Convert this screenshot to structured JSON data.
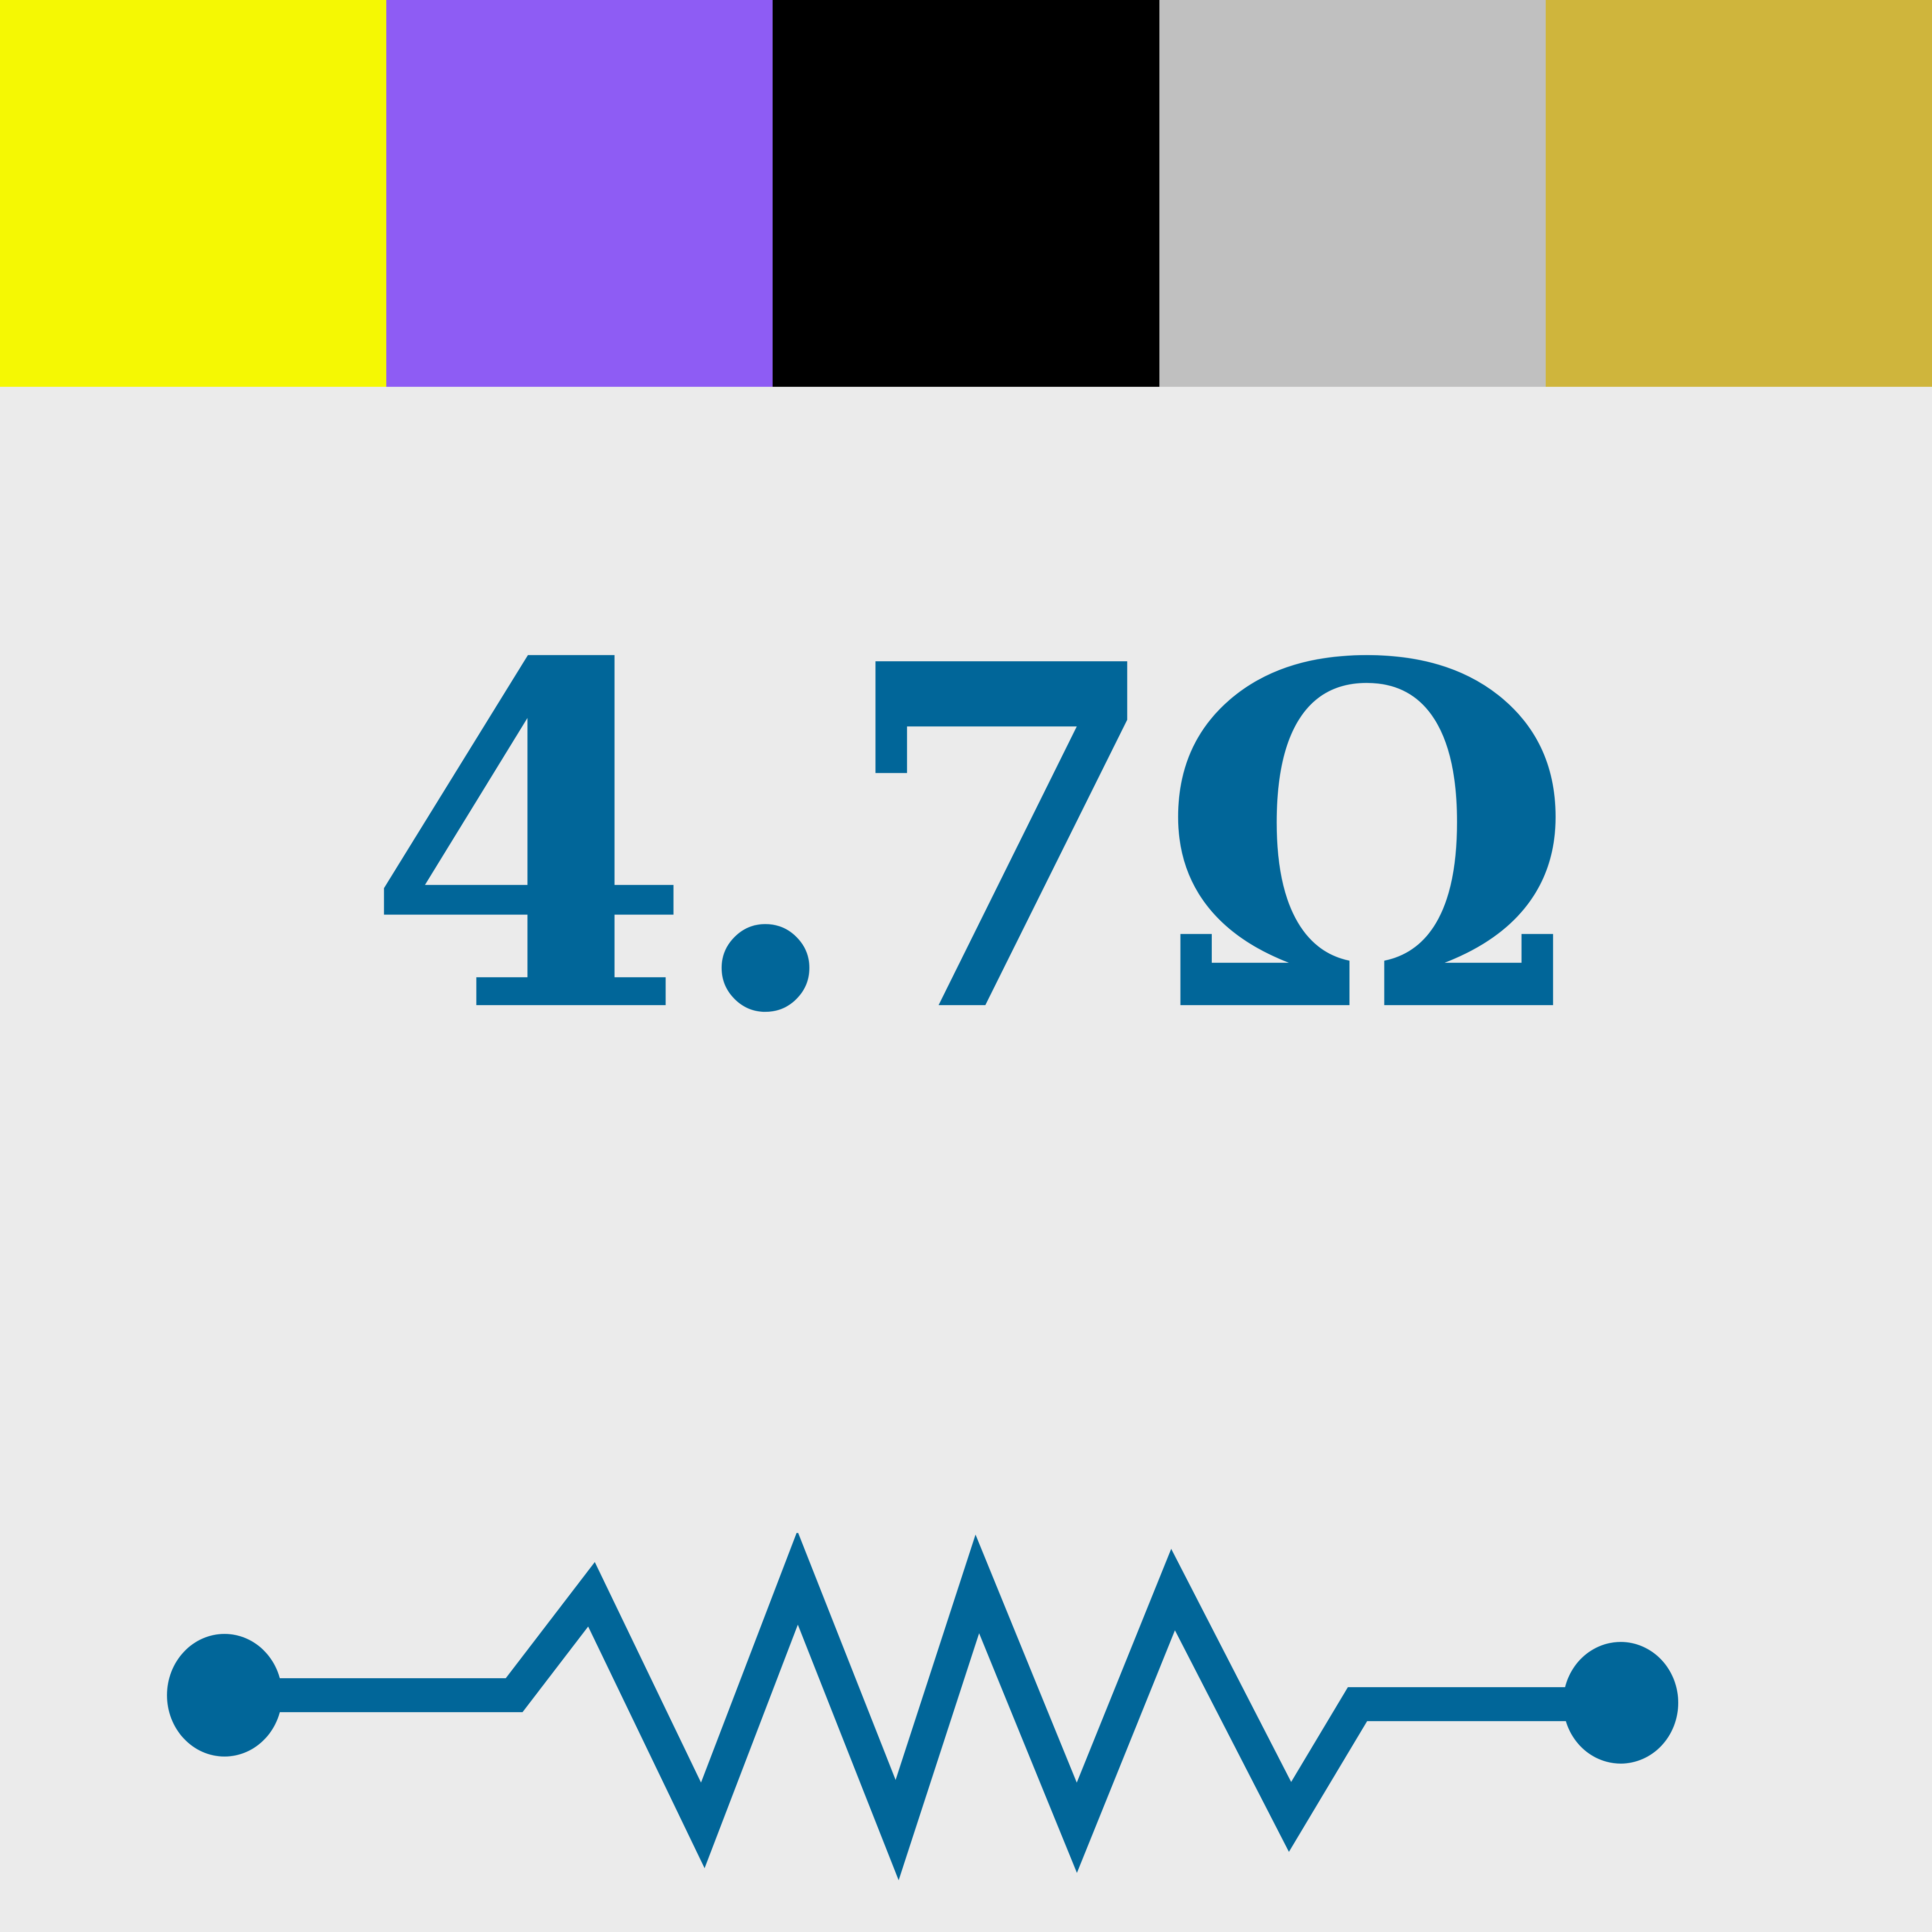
{
  "color_bands": [
    {
      "name": "band-1",
      "color": "#F5F803"
    },
    {
      "name": "band-2",
      "color": "#8E5CF4"
    },
    {
      "name": "band-3",
      "color": "#000000"
    },
    {
      "name": "band-4",
      "color": "#C0C0C0"
    },
    {
      "name": "band-5",
      "color": "#CFB53C"
    }
  ],
  "resistance": {
    "label": "4.7Ω"
  },
  "symbol": {
    "icon": "resistor-symbol-icon",
    "color": "#016699"
  }
}
